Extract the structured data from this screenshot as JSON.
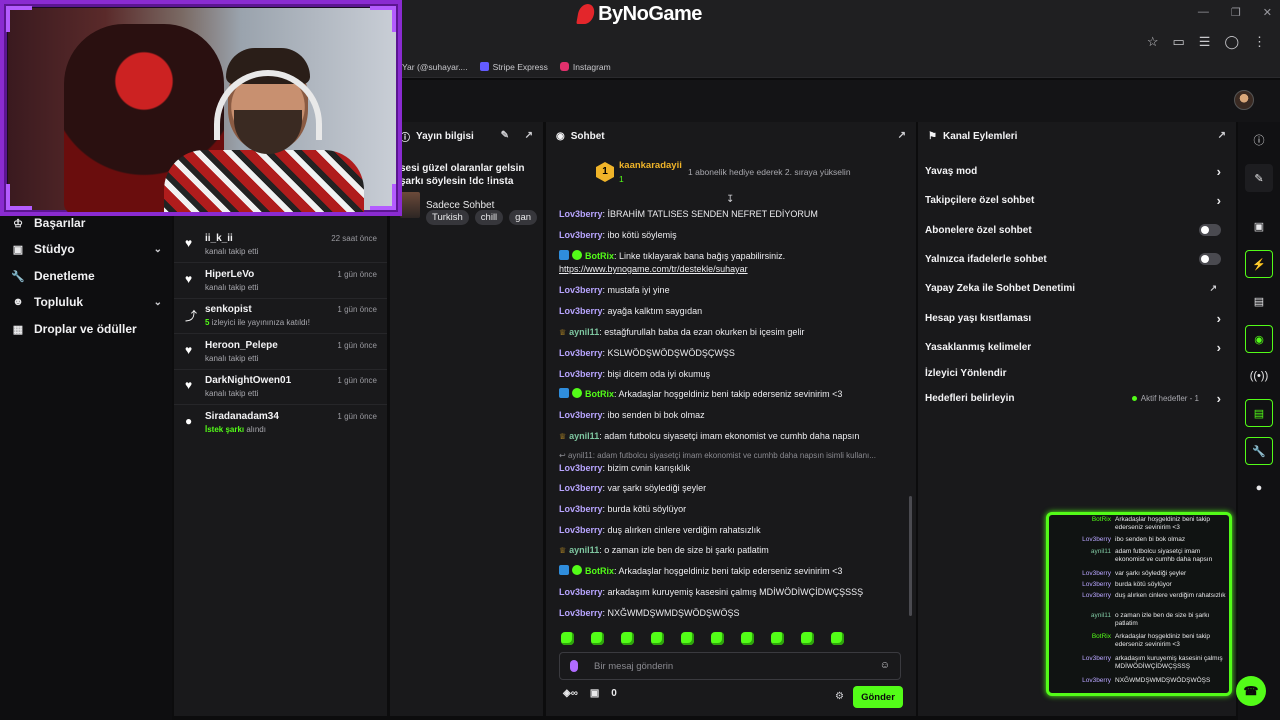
{
  "brand": {
    "name": "ByNoGame"
  },
  "bookmarks": [
    {
      "label": "Yar (@suhayar....",
      "color": "#a8a8ae"
    },
    {
      "label": "Stripe Express",
      "color": "#635bff"
    },
    {
      "label": "Instagram",
      "color": "#e1306c"
    }
  ],
  "nav": {
    "items": [
      {
        "label": "Başarılar",
        "icon": "trophy-icon"
      },
      {
        "label": "Stüdyo",
        "icon": "studio-icon"
      },
      {
        "label": "Denetleme",
        "icon": "wrench-icon"
      },
      {
        "label": "Topluluk",
        "icon": "community-icon"
      },
      {
        "label": "Droplar ve ödüller",
        "icon": "gift-icon"
      }
    ]
  },
  "activity": [
    {
      "name": "ii_k_ii",
      "sub": "kanalı takip etti",
      "time": "22 saat önce",
      "icon": "heart-icon"
    },
    {
      "name": "HiperLeVo",
      "sub": "kanalı takip etti",
      "time": "1 gün önce",
      "icon": "heart-icon"
    },
    {
      "name": "senkopist",
      "sub_highlight": "5",
      "sub": " izleyici ile yayınınıza katıldı!",
      "time": "1 gün önce",
      "icon": "raid-icon"
    },
    {
      "name": "Heroon_Pelepe",
      "sub": "kanalı takip etti",
      "time": "1 gün önce",
      "icon": "heart-icon"
    },
    {
      "name": "DarkNightOwen01",
      "sub": "kanalı takip etti",
      "time": "1 gün önce",
      "icon": "heart-icon"
    },
    {
      "name": "Siradanadam34",
      "sub_highlight": "İstek şarkı",
      "sub": " alındı",
      "time": "1 gün önce",
      "icon": "song-request-icon"
    }
  ],
  "stream_info": {
    "header": "Yayın bilgisi",
    "title_line1": "sesi güzel olaranlar gelsin",
    "title_line2": "şarkı söylesin !dc !insta",
    "category": "Sadece Sohbet",
    "tags": [
      "Turkish",
      "chill",
      "gan"
    ]
  },
  "chat": {
    "header": "Sohbet",
    "gift": {
      "rank": "1",
      "name": "kaankaradayii",
      "count": "1",
      "note": "1 abonelik hediye ederek 2. sıraya yükselin"
    },
    "messages": [
      {
        "user": "Lov3berry",
        "text": "İBRAHİM TATLISES SENDEN NEFRET EDİYORUM"
      },
      {
        "user": "Lov3berry",
        "text": "ibo kötü söylemiş"
      },
      {
        "user": "BotRix",
        "text": "Linke tıklayarak bana bağış yapabilirsiniz.",
        "link": "https://www.bynogame.com/tr/destekle/suhayar"
      },
      {
        "user": "Lov3berry",
        "text": "mustafa iyi yine"
      },
      {
        "user": "Lov3berry",
        "text": "ayağa kalktım saygıdan"
      },
      {
        "user": "aynil11",
        "text": "estağfurullah baba da ezan okurken bi içesim gelir"
      },
      {
        "user": "Lov3berry",
        "text": "KSLWÖDŞWÖDŞWÖDŞÇWŞS"
      },
      {
        "user": "Lov3berry",
        "text": "bişi dicem oda iyi okumuş"
      },
      {
        "user": "BotRix",
        "text": "Arkadaşlar hoşgeldiniz beni takip ederseniz sevinirim <3"
      },
      {
        "user": "Lov3berry",
        "text": "ibo senden bi bok olmaz"
      },
      {
        "user": "aynil11",
        "text": "adam futbolcu siyasetçi imam ekonomist ve cumhb daha napsın"
      },
      {
        "reply": "aynil11: adam futbolcu siyasetçi imam ekonomist ve cumhb daha napsın isimli kullanı...",
        "user": "Lov3berry",
        "text": "bizim cvnin karışıklık"
      },
      {
        "user": "Lov3berry",
        "text": "var şarkı söylediği şeyler"
      },
      {
        "user": "Lov3berry",
        "text": "burda kötü söylüyor"
      },
      {
        "user": "Lov3berry",
        "text": "duş alırken cinlere verdiğim rahatsızlık"
      },
      {
        "user": "aynil11",
        "text": "o zaman izle ben de size bi şarkı patlatim"
      },
      {
        "user": "BotRix",
        "text": "Arkadaşlar hoşgeldiniz beni takip ederseniz sevinirim <3"
      },
      {
        "user": "Lov3berry",
        "text": "arkadaşım kuruyemiş kasesini çalmış MDİWÖDİWÇİDWÇŞSSŞ"
      },
      {
        "user": "Lov3berry",
        "text": "NXĞWMDŞWMDŞWÖDŞWÖŞS"
      }
    ],
    "placeholder": "Bir mesaj gönderin",
    "points": "0",
    "send": "Gönder"
  },
  "mod": {
    "header": "Kanal Eylemleri",
    "rows": [
      {
        "label": "Yavaş mod",
        "control": "arrow"
      },
      {
        "label": "Takipçilere özel sohbet",
        "control": "arrow"
      },
      {
        "label": "Abonelere özel sohbet",
        "control": "toggle"
      },
      {
        "label": "Yalnızca ifadelerle sohbet",
        "control": "toggle"
      },
      {
        "label": "Yapay Zeka ile Sohbet Denetimi",
        "control": "external"
      },
      {
        "label": "Hesap yaşı kısıtlaması",
        "control": "arrow"
      },
      {
        "label": "Yasaklanmış kelimeler",
        "control": "arrow"
      },
      {
        "label": "İzleyici Yönlendir",
        "control": "none"
      },
      {
        "label": "Hedefleri belirleyin",
        "control": "arrow",
        "status": "Aktif hedefler - 1"
      }
    ]
  },
  "overlay": [
    {
      "user": "BotRix",
      "text": "Arkadaşlar hoşgeldiniz beni takip ederseniz sevinirim <3"
    },
    {
      "user": "Lov3berry",
      "text": "ibo senden bi bok olmaz"
    },
    {
      "user": "aynil11",
      "text": "adam futbolcu siyasetçi imam ekonomist ve cumhb daha napsın"
    },
    {
      "user": "Lov3berry",
      "text": "var şarkı söylediği şeyler"
    },
    {
      "user": "Lov3berry",
      "text": "burda kötü söylüyor"
    },
    {
      "user": "Lov3berry",
      "text": "duş alırken cinlere verdiğim rahatsızlık"
    },
    {
      "user": "aynil11",
      "text": "o zaman izle ben de size bi şarkı patlatim"
    },
    {
      "user": "BotRix",
      "text": "Arkadaşlar hoşgeldiniz beni takip ederseniz sevinirim <3"
    },
    {
      "user": "Lov3berry",
      "text": "arkadaşım kuruyemiş kasesini çalmış MDİWÖDİWÇİDWÇŞSSŞ"
    },
    {
      "user": "Lov3berry",
      "text": "NXĞWMDŞWMDŞWÖDŞWÖŞS"
    }
  ],
  "rail": [
    "info-icon",
    "edit-icon",
    "screen-capture-icon",
    "lightning-icon",
    "document-icon",
    "chat-icon",
    "broadcast-icon",
    "printer-icon",
    "wrench-icon",
    "community-icon"
  ],
  "colors": {
    "accent": "#53fc18",
    "cam_frame": "#8a2bd1",
    "username": "#b8a5ff"
  }
}
